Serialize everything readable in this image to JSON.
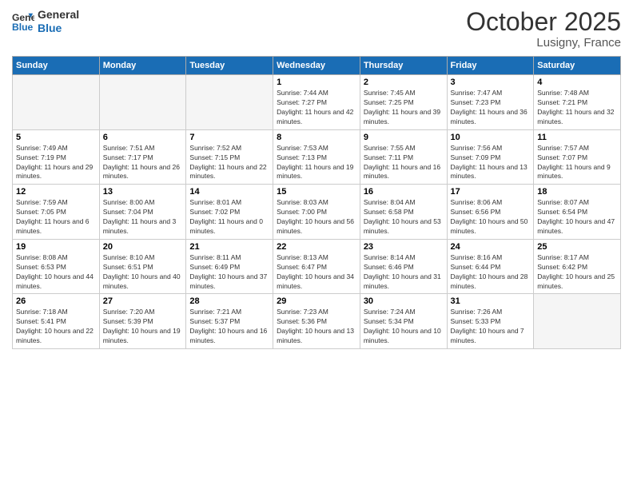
{
  "header": {
    "logo_line1": "General",
    "logo_line2": "Blue",
    "month": "October 2025",
    "location": "Lusigny, France"
  },
  "weekdays": [
    "Sunday",
    "Monday",
    "Tuesday",
    "Wednesday",
    "Thursday",
    "Friday",
    "Saturday"
  ],
  "weeks": [
    [
      {
        "day": "",
        "empty": true
      },
      {
        "day": "",
        "empty": true
      },
      {
        "day": "",
        "empty": true
      },
      {
        "day": "1",
        "sunrise": "7:44 AM",
        "sunset": "7:27 PM",
        "daylight": "11 hours and 42 minutes."
      },
      {
        "day": "2",
        "sunrise": "7:45 AM",
        "sunset": "7:25 PM",
        "daylight": "11 hours and 39 minutes."
      },
      {
        "day": "3",
        "sunrise": "7:47 AM",
        "sunset": "7:23 PM",
        "daylight": "11 hours and 36 minutes."
      },
      {
        "day": "4",
        "sunrise": "7:48 AM",
        "sunset": "7:21 PM",
        "daylight": "11 hours and 32 minutes."
      }
    ],
    [
      {
        "day": "5",
        "sunrise": "7:49 AM",
        "sunset": "7:19 PM",
        "daylight": "11 hours and 29 minutes."
      },
      {
        "day": "6",
        "sunrise": "7:51 AM",
        "sunset": "7:17 PM",
        "daylight": "11 hours and 26 minutes."
      },
      {
        "day": "7",
        "sunrise": "7:52 AM",
        "sunset": "7:15 PM",
        "daylight": "11 hours and 22 minutes."
      },
      {
        "day": "8",
        "sunrise": "7:53 AM",
        "sunset": "7:13 PM",
        "daylight": "11 hours and 19 minutes."
      },
      {
        "day": "9",
        "sunrise": "7:55 AM",
        "sunset": "7:11 PM",
        "daylight": "11 hours and 16 minutes."
      },
      {
        "day": "10",
        "sunrise": "7:56 AM",
        "sunset": "7:09 PM",
        "daylight": "11 hours and 13 minutes."
      },
      {
        "day": "11",
        "sunrise": "7:57 AM",
        "sunset": "7:07 PM",
        "daylight": "11 hours and 9 minutes."
      }
    ],
    [
      {
        "day": "12",
        "sunrise": "7:59 AM",
        "sunset": "7:05 PM",
        "daylight": "11 hours and 6 minutes."
      },
      {
        "day": "13",
        "sunrise": "8:00 AM",
        "sunset": "7:04 PM",
        "daylight": "11 hours and 3 minutes."
      },
      {
        "day": "14",
        "sunrise": "8:01 AM",
        "sunset": "7:02 PM",
        "daylight": "11 hours and 0 minutes."
      },
      {
        "day": "15",
        "sunrise": "8:03 AM",
        "sunset": "7:00 PM",
        "daylight": "10 hours and 56 minutes."
      },
      {
        "day": "16",
        "sunrise": "8:04 AM",
        "sunset": "6:58 PM",
        "daylight": "10 hours and 53 minutes."
      },
      {
        "day": "17",
        "sunrise": "8:06 AM",
        "sunset": "6:56 PM",
        "daylight": "10 hours and 50 minutes."
      },
      {
        "day": "18",
        "sunrise": "8:07 AM",
        "sunset": "6:54 PM",
        "daylight": "10 hours and 47 minutes."
      }
    ],
    [
      {
        "day": "19",
        "sunrise": "8:08 AM",
        "sunset": "6:53 PM",
        "daylight": "10 hours and 44 minutes."
      },
      {
        "day": "20",
        "sunrise": "8:10 AM",
        "sunset": "6:51 PM",
        "daylight": "10 hours and 40 minutes."
      },
      {
        "day": "21",
        "sunrise": "8:11 AM",
        "sunset": "6:49 PM",
        "daylight": "10 hours and 37 minutes."
      },
      {
        "day": "22",
        "sunrise": "8:13 AM",
        "sunset": "6:47 PM",
        "daylight": "10 hours and 34 minutes."
      },
      {
        "day": "23",
        "sunrise": "8:14 AM",
        "sunset": "6:46 PM",
        "daylight": "10 hours and 31 minutes."
      },
      {
        "day": "24",
        "sunrise": "8:16 AM",
        "sunset": "6:44 PM",
        "daylight": "10 hours and 28 minutes."
      },
      {
        "day": "25",
        "sunrise": "8:17 AM",
        "sunset": "6:42 PM",
        "daylight": "10 hours and 25 minutes."
      }
    ],
    [
      {
        "day": "26",
        "sunrise": "7:18 AM",
        "sunset": "5:41 PM",
        "daylight": "10 hours and 22 minutes."
      },
      {
        "day": "27",
        "sunrise": "7:20 AM",
        "sunset": "5:39 PM",
        "daylight": "10 hours and 19 minutes."
      },
      {
        "day": "28",
        "sunrise": "7:21 AM",
        "sunset": "5:37 PM",
        "daylight": "10 hours and 16 minutes."
      },
      {
        "day": "29",
        "sunrise": "7:23 AM",
        "sunset": "5:36 PM",
        "daylight": "10 hours and 13 minutes."
      },
      {
        "day": "30",
        "sunrise": "7:24 AM",
        "sunset": "5:34 PM",
        "daylight": "10 hours and 10 minutes."
      },
      {
        "day": "31",
        "sunrise": "7:26 AM",
        "sunset": "5:33 PM",
        "daylight": "10 hours and 7 minutes."
      },
      {
        "day": "",
        "empty": true
      }
    ]
  ]
}
